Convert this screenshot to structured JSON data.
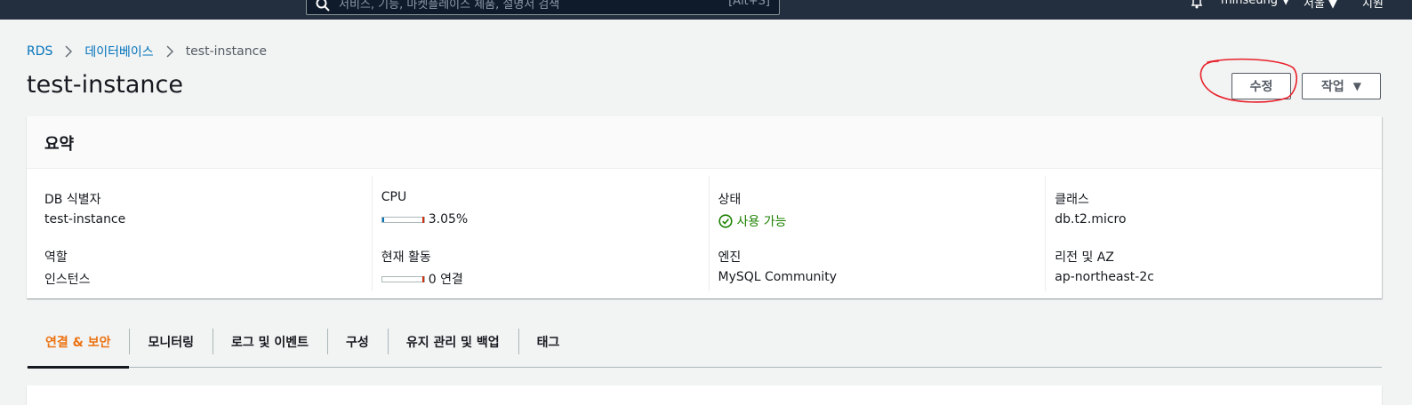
{
  "topnav": {
    "search_placeholder": "서비스, 기능, 마켓플레이스 제품, 설명서 검색",
    "search_shortcut": "[Alt+S]",
    "user": "minseung ▼",
    "region": "서울 ▼",
    "support": "지원"
  },
  "breadcrumb": [
    "RDS",
    "데이터베이스",
    "test-instance"
  ],
  "page_title": "test-instance",
  "actions": {
    "edit": "수정",
    "action": "작업",
    "action_caret": "▼"
  },
  "summary": {
    "heading": "요약",
    "db_id_label": "DB 식별자",
    "db_id": "test-instance",
    "role_label": "역할",
    "role": "인스턴스",
    "cpu_label": "CPU",
    "cpu_value": "3.05%",
    "cpu_fraction": 0.0305,
    "activity_label": "현재 활동",
    "activity_value": "0 연결",
    "activity_fraction": 0,
    "status_label": "상태",
    "status": "사용 가능",
    "status_color": "#1d8102",
    "engine_label": "엔진",
    "engine": "MySQL Community",
    "class_label": "클래스",
    "class": "db.t2.micro",
    "az_label": "리전 및 AZ",
    "az": "ap-northeast-2c"
  },
  "tabs": [
    "연결 & 보안",
    "모니터링",
    "로그 및 이벤트",
    "구성",
    "유지 관리 및 백업",
    "태그"
  ],
  "colors": {
    "accent": "#ec7211",
    "link": "#0073bb",
    "nav": "#232f3e"
  }
}
